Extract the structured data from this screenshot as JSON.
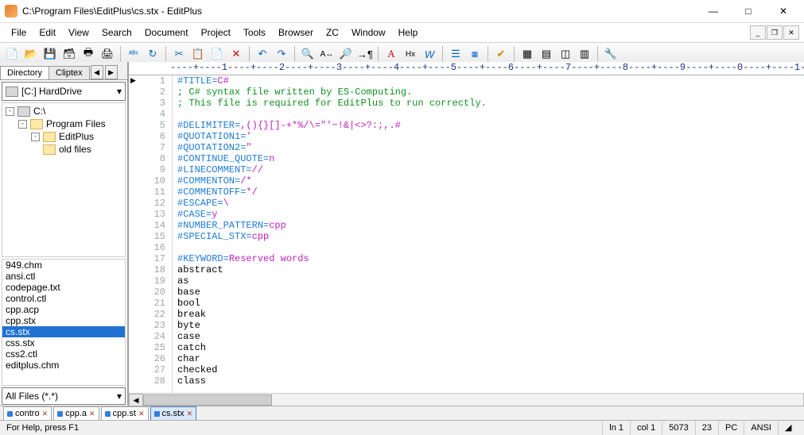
{
  "window": {
    "title": "C:\\Program Files\\EditPlus\\cs.stx - EditPlus"
  },
  "menu": {
    "items": [
      "File",
      "Edit",
      "View",
      "Search",
      "Document",
      "Project",
      "Tools",
      "Browser",
      "ZC",
      "Window",
      "Help"
    ]
  },
  "sidebar": {
    "tab_directory": "Directory",
    "tab_cliptext": "Cliptex",
    "drive_label": "[C:] HardDrive",
    "tree": [
      {
        "label": "C:\\",
        "depth": 0,
        "type": "drive"
      },
      {
        "label": "Program Files",
        "depth": 1,
        "type": "folder"
      },
      {
        "label": "EditPlus",
        "depth": 2,
        "type": "folder"
      },
      {
        "label": "old files",
        "depth": 2,
        "type": "folder"
      }
    ],
    "files": [
      "949.chm",
      "ansi.ctl",
      "codepage.txt",
      "control.ctl",
      "cpp.acp",
      "cpp.stx",
      "cs.stx",
      "css.stx",
      "css2.ctl",
      "editplus.chm"
    ],
    "selected_file": "cs.stx",
    "filter_label": "All Files (*.*)"
  },
  "ruler": "----+----1----+----2----+----3----+----4----+----5----+----6----+----7----+----8----+----9----+----0----+----1---",
  "code_lines": [
    {
      "n": 1,
      "segs": [
        {
          "t": "#TITLE=",
          "c": "dir"
        },
        {
          "t": "C#",
          "c": "val"
        }
      ]
    },
    {
      "n": 2,
      "segs": [
        {
          "t": "; C# syntax file written by ES-Computing.",
          "c": "cmt"
        }
      ]
    },
    {
      "n": 3,
      "segs": [
        {
          "t": "; This file is required for EditPlus to run correctly.",
          "c": "cmt"
        }
      ]
    },
    {
      "n": 4,
      "segs": []
    },
    {
      "n": 5,
      "segs": [
        {
          "t": "#DELIMITER=",
          "c": "dir"
        },
        {
          "t": ",(){}[]-+*%/\\=\"'~!&|<>?:;,.#",
          "c": "val"
        }
      ]
    },
    {
      "n": 6,
      "segs": [
        {
          "t": "#QUOTATION1=",
          "c": "dir"
        },
        {
          "t": "'",
          "c": "val"
        }
      ]
    },
    {
      "n": 7,
      "segs": [
        {
          "t": "#QUOTATION2=",
          "c": "dir"
        },
        {
          "t": "\"",
          "c": "val"
        }
      ]
    },
    {
      "n": 8,
      "segs": [
        {
          "t": "#CONTINUE_QUOTE=",
          "c": "dir"
        },
        {
          "t": "n",
          "c": "val"
        }
      ]
    },
    {
      "n": 9,
      "segs": [
        {
          "t": "#LINECOMMENT=",
          "c": "dir"
        },
        {
          "t": "//",
          "c": "val"
        }
      ]
    },
    {
      "n": 10,
      "segs": [
        {
          "t": "#COMMENTON=",
          "c": "dir"
        },
        {
          "t": "/*",
          "c": "val"
        }
      ]
    },
    {
      "n": 11,
      "segs": [
        {
          "t": "#COMMENTOFF=",
          "c": "dir"
        },
        {
          "t": "*/",
          "c": "val"
        }
      ]
    },
    {
      "n": 12,
      "segs": [
        {
          "t": "#ESCAPE=",
          "c": "dir"
        },
        {
          "t": "\\",
          "c": "val"
        }
      ]
    },
    {
      "n": 13,
      "segs": [
        {
          "t": "#CASE=",
          "c": "dir"
        },
        {
          "t": "y",
          "c": "val"
        }
      ]
    },
    {
      "n": 14,
      "segs": [
        {
          "t": "#NUMBER_PATTERN=",
          "c": "dir"
        },
        {
          "t": "cpp",
          "c": "val"
        }
      ]
    },
    {
      "n": 15,
      "segs": [
        {
          "t": "#SPECIAL_STX=",
          "c": "dir"
        },
        {
          "t": "cpp",
          "c": "val"
        }
      ]
    },
    {
      "n": 16,
      "segs": []
    },
    {
      "n": 17,
      "segs": [
        {
          "t": "#KEYWORD=",
          "c": "dir"
        },
        {
          "t": "Reserved words",
          "c": "val"
        }
      ]
    },
    {
      "n": 18,
      "segs": [
        {
          "t": "abstract",
          "c": "txt"
        }
      ]
    },
    {
      "n": 19,
      "segs": [
        {
          "t": "as",
          "c": "txt"
        }
      ]
    },
    {
      "n": 20,
      "segs": [
        {
          "t": "base",
          "c": "txt"
        }
      ]
    },
    {
      "n": 21,
      "segs": [
        {
          "t": "bool",
          "c": "txt"
        }
      ]
    },
    {
      "n": 22,
      "segs": [
        {
          "t": "break",
          "c": "txt"
        }
      ]
    },
    {
      "n": 23,
      "segs": [
        {
          "t": "byte",
          "c": "txt"
        }
      ]
    },
    {
      "n": 24,
      "segs": [
        {
          "t": "case",
          "c": "txt"
        }
      ]
    },
    {
      "n": 25,
      "segs": [
        {
          "t": "catch",
          "c": "txt"
        }
      ]
    },
    {
      "n": 26,
      "segs": [
        {
          "t": "char",
          "c": "txt"
        }
      ]
    },
    {
      "n": 27,
      "segs": [
        {
          "t": "checked",
          "c": "txt"
        }
      ]
    },
    {
      "n": 28,
      "segs": [
        {
          "t": "class",
          "c": "txt"
        }
      ]
    }
  ],
  "current_line": 1,
  "doctabs": [
    {
      "label": "contro",
      "active": false
    },
    {
      "label": "cpp.a",
      "active": false
    },
    {
      "label": "cpp.st",
      "active": false
    },
    {
      "label": "cs.stx",
      "active": true
    }
  ],
  "status": {
    "help": "For Help, press F1",
    "line": "ln 1",
    "col": "col 1",
    "chars": "5073",
    "sel": "23",
    "mode": "PC",
    "enc": "ANSI"
  }
}
